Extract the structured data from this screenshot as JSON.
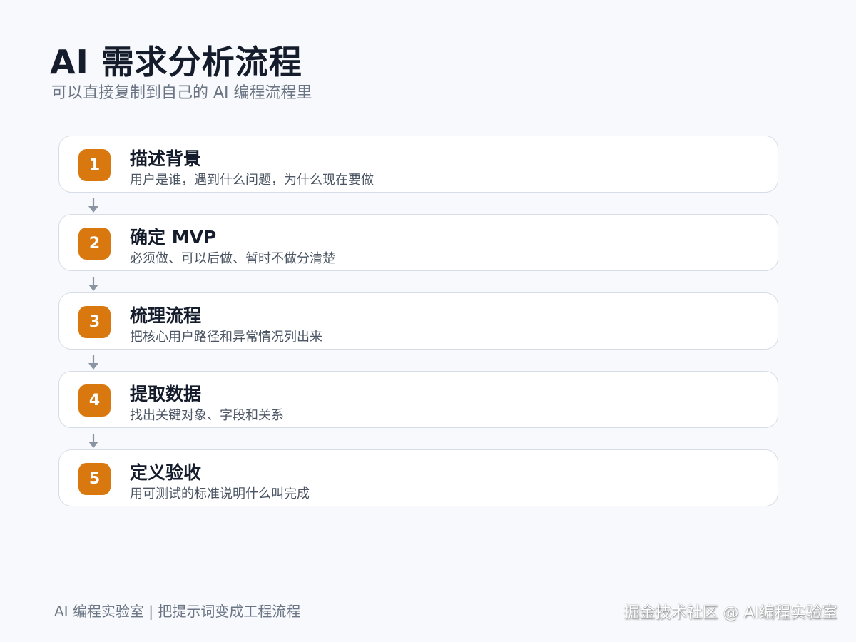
{
  "header": {
    "title": "AI 需求分析流程",
    "subtitle": "可以直接复制到自己的 AI 编程流程里"
  },
  "steps": [
    {
      "number": "1",
      "title": "描述背景",
      "description": "用户是谁，遇到什么问题，为什么现在要做"
    },
    {
      "number": "2",
      "title": "确定 MVP",
      "description": "必须做、可以后做、暂时不做分清楚"
    },
    {
      "number": "3",
      "title": "梳理流程",
      "description": "把核心用户路径和异常情况列出来"
    },
    {
      "number": "4",
      "title": "提取数据",
      "description": "找出关键对象、字段和关系"
    },
    {
      "number": "5",
      "title": "定义验收",
      "description": "用可测试的标准说明什么叫完成"
    }
  ],
  "footer": {
    "caption": "AI 编程实验室 | 把提示词变成工程流程",
    "watermark": "掘金技术社区 @ AI编程实验室"
  },
  "colors": {
    "background": "#f7f9fc",
    "card_border": "#d7dde6",
    "badge": "#d9780f",
    "arrow": "#8a94a3"
  }
}
